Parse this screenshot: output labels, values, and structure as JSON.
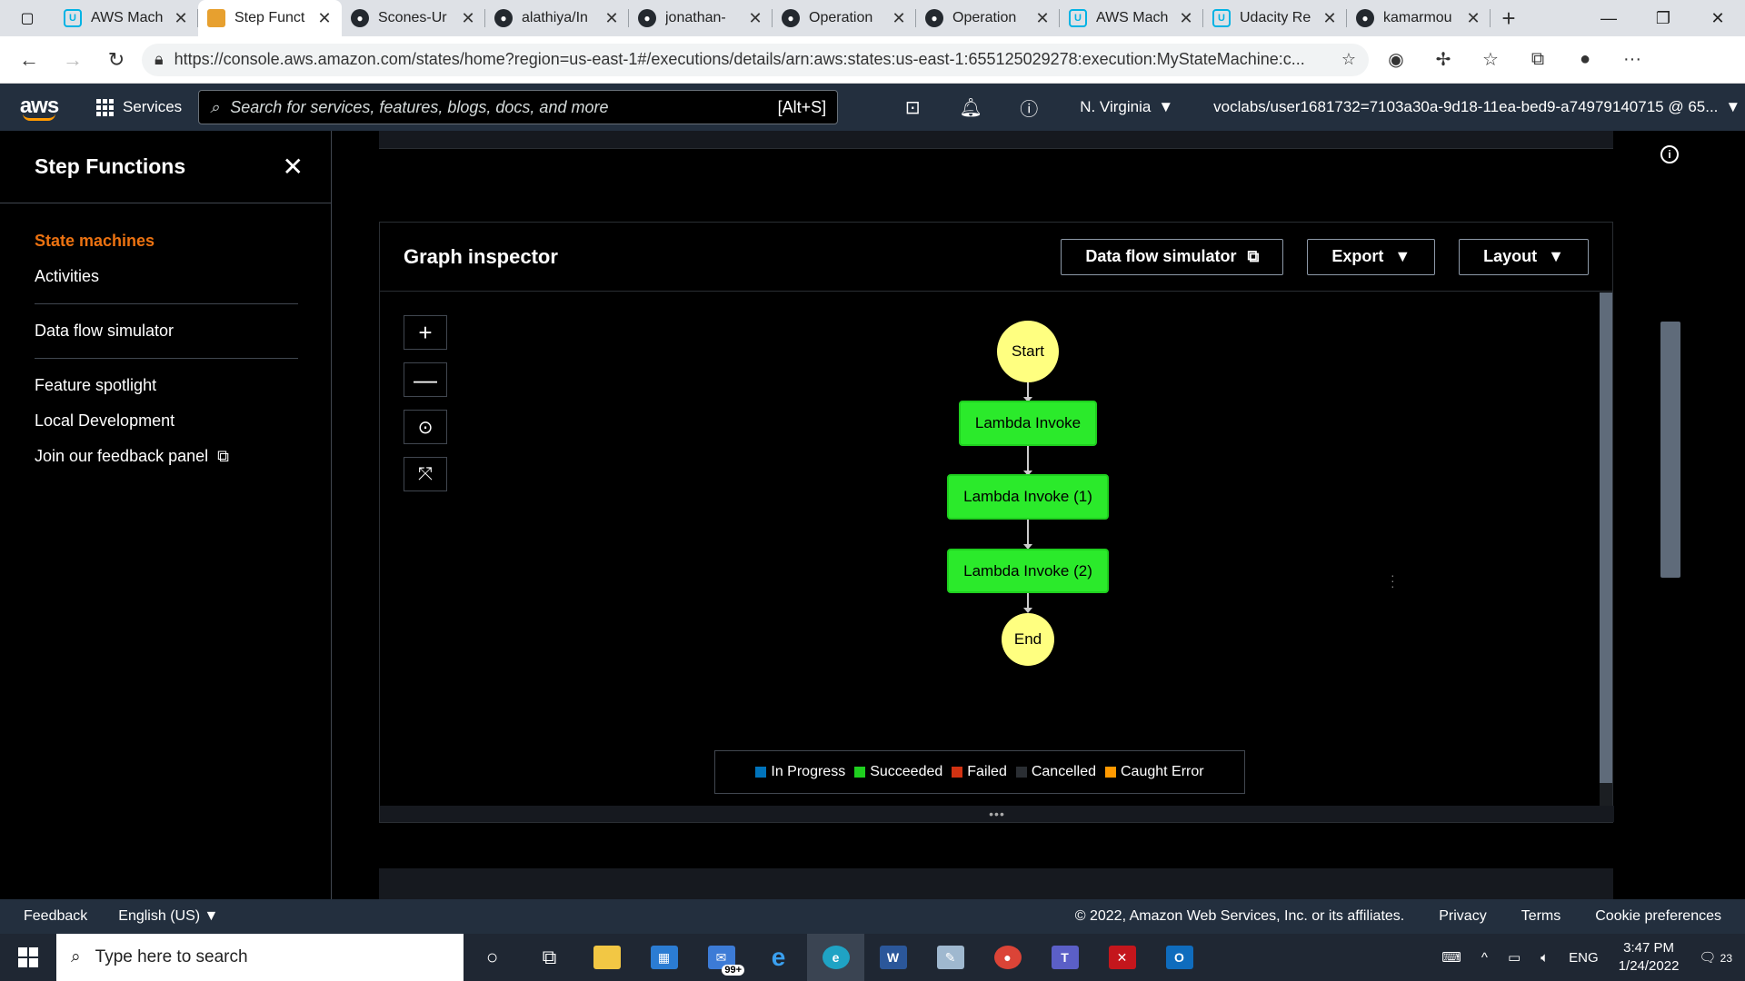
{
  "browser": {
    "tabs": [
      {
        "title": "AWS Mach",
        "icon": "udacity-icon",
        "active": false
      },
      {
        "title": "Step Funct",
        "icon": "step-functions-icon",
        "active": true
      },
      {
        "title": "Scones-Ur",
        "icon": "github-icon",
        "active": false
      },
      {
        "title": "alathiya/In",
        "icon": "github-icon",
        "active": false
      },
      {
        "title": "jonathan-",
        "icon": "github-icon",
        "active": false
      },
      {
        "title": "Operation",
        "icon": "github-icon",
        "active": false
      },
      {
        "title": "Operation",
        "icon": "github-icon",
        "active": false
      },
      {
        "title": "AWS Mach",
        "icon": "udacity-icon",
        "active": false
      },
      {
        "title": "Udacity Re",
        "icon": "udacity-icon",
        "active": false
      },
      {
        "title": "kamarmou",
        "icon": "github-icon",
        "active": false
      }
    ],
    "url": "https://console.aws.amazon.com/states/home?region=us-east-1#/executions/details/arn:aws:states:us-east-1:655125029278:execution:MyStateMachine:c..."
  },
  "awsnav": {
    "logo": "aws",
    "services_label": "Services",
    "search_placeholder": "Search for services, features, blogs, docs, and more",
    "search_shortcut": "[Alt+S]",
    "region": "N. Virginia",
    "account": "voclabs/user1681732=7103a30a-9d18-11ea-bed9-a74979140715 @ 65..."
  },
  "sidebar": {
    "title": "Step Functions",
    "items": [
      {
        "label": "State machines",
        "active": true
      },
      {
        "label": "Activities",
        "active": false
      },
      {
        "label": "Data flow simulator",
        "active": false
      },
      {
        "label": "Feature spotlight",
        "active": false
      },
      {
        "label": "Local Development",
        "active": false
      },
      {
        "label": "Join our feedback panel",
        "active": false
      }
    ]
  },
  "graph": {
    "title": "Graph inspector",
    "buttons": {
      "simulator": "Data flow simulator",
      "export": "Export",
      "layout": "Layout"
    },
    "nodes": {
      "start": "Start",
      "task1": "Lambda Invoke",
      "task2": "Lambda Invoke (1)",
      "task3": "Lambda Invoke (2)",
      "end": "End"
    },
    "legend": [
      {
        "label": "In Progress",
        "color": "#0073bb"
      },
      {
        "label": "Succeeded",
        "color": "#1fcf1f"
      },
      {
        "label": "Failed",
        "color": "#d13212"
      },
      {
        "label": "Cancelled",
        "color": "#2a2e33"
      },
      {
        "label": "Caught Error",
        "color": "#ff9900"
      }
    ]
  },
  "footer": {
    "feedback": "Feedback",
    "language": "English (US)",
    "copyright": "© 2022, Amazon Web Services, Inc. or its affiliates.",
    "privacy": "Privacy",
    "terms": "Terms",
    "cookies": "Cookie preferences"
  },
  "taskbar": {
    "search_placeholder": "Type here to search",
    "mail_badge": "99+",
    "language": "ENG",
    "time": "3:47 PM",
    "date": "1/24/2022",
    "notifications": "23"
  }
}
